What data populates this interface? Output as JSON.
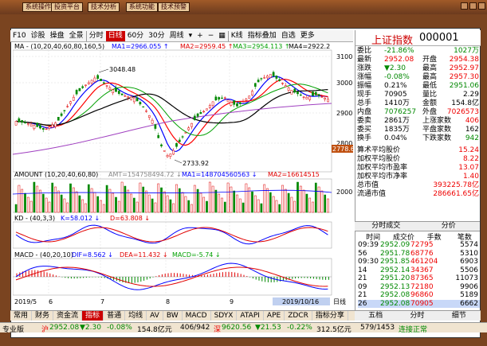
{
  "top_menu": [
    "系统操作",
    "投资平台",
    "技术分析",
    "系统功能",
    "技术预警"
  ],
  "toolbar": {
    "items": [
      "F10",
      "诊股",
      "操盘",
      "全景",
      "分时",
      "日线",
      "60分",
      "30分",
      "周线",
      "K线",
      "指标叠加",
      "自选",
      "更多"
    ],
    "active": "日线"
  },
  "ma_legend": {
    "label": "MA - (10,20,40,60,80,160,5)",
    "ma1": "MA1=2966.055 ↑",
    "ma2": "MA2=2959.45 ↑",
    "ma3": "MA3=2954.113 ↑",
    "ma4": "MA4=2922.2"
  },
  "price_axis": [
    "3100",
    "3000",
    "2900",
    "2800"
  ],
  "price_annotations": {
    "high": "3048.48",
    "low": "2733.92",
    "current": "2778.60"
  },
  "amount_legend": {
    "label": "AMOUNT (10,20,40,60,80)",
    "amt": "AMT=154758494.72 ↓",
    "ma1": "MA1=148704560563 ↓",
    "ma2": "MA2=16614515"
  },
  "amount_axis": "2000",
  "kd_legend": {
    "label": "KD - (40,3,3)",
    "k": "K=58.012 ↓",
    "d": "D=63.808 ↓"
  },
  "macd_legend": {
    "label": "MACD - (40,20,10)",
    "dif": "DIF=8.562 ↓",
    "dea": "DEA=11.432 ↓",
    "macd": "MACD=-5.74 ↓"
  },
  "x_axis": [
    "2019/5",
    "6",
    "7",
    "8",
    "9"
  ],
  "x_current": "2019/10/16",
  "x_suffix": "日线",
  "right_panel": {
    "title_name": "上证指数",
    "title_code": "000001",
    "rows": [
      {
        "l": "委比",
        "lv": "-21.86%",
        "r": "",
        "rv": "1027万",
        "lc": "green",
        "rc": "green"
      },
      {
        "l": "最新",
        "lv": "2952.08",
        "r": "开盘",
        "rv": "2954.38",
        "lc": "red",
        "rc": "red"
      },
      {
        "l": "涨跌",
        "lv": "▼2.30",
        "r": "最高",
        "rv": "2952.97",
        "lc": "green",
        "rc": "red"
      },
      {
        "l": "涨幅",
        "lv": "-0.08%",
        "r": "最高",
        "rv": "2957.30",
        "lc": "green",
        "rc": "red"
      },
      {
        "l": "振幅",
        "lv": "0.21%",
        "r": "最低",
        "rv": "2951.06",
        "lc": "black",
        "rc": "green"
      },
      {
        "l": "现手",
        "lv": "70905",
        "r": "量比",
        "rv": "2.29",
        "lc": "black",
        "rc": "black"
      },
      {
        "l": "总手",
        "lv": "1410万",
        "r": "金额",
        "rv": "154.8亿",
        "lc": "black",
        "rc": "black"
      },
      {
        "l": "内盘",
        "lv": "7076257",
        "r": "外盘",
        "rv": "7026573",
        "lc": "green",
        "rc": "red"
      },
      {
        "l": "委卖",
        "lv": "2861万",
        "r": "上涨家数",
        "rv": "406",
        "lc": "black",
        "rc": "red"
      },
      {
        "l": "委买",
        "lv": "1835万",
        "r": "平盘家数",
        "rv": "162",
        "lc": "black",
        "rc": "black"
      },
      {
        "l": "换手",
        "lv": "0.04%",
        "r": "下跌家数",
        "rv": "942",
        "lc": "black",
        "rc": "green"
      }
    ],
    "stats": [
      {
        "l": "算术平均股价",
        "v": "15.24"
      },
      {
        "l": "加权平均股价",
        "v": "8.22"
      },
      {
        "l": "加权平均市盈率",
        "v": "13.07"
      },
      {
        "l": "加权平均市净率",
        "v": "1.40"
      },
      {
        "l": "总市值",
        "v": "393225.78亿"
      },
      {
        "l": "流通市值",
        "v": "286661.65亿"
      }
    ],
    "tabs": [
      "分时成交",
      "分价"
    ],
    "tick_headers": [
      "时间",
      "成交价",
      "手数",
      "笔数"
    ],
    "ticks": [
      {
        "t": "09:39",
        "p": "2952.09",
        "v": "72795",
        "n": "5574"
      },
      {
        "t": "56",
        "p": "2951.78",
        "v": "68776",
        "n": "5310"
      },
      {
        "t": "09:30",
        "p": "2951.85",
        "v": "461204",
        "n": "6903"
      },
      {
        "t": "14",
        "p": "2952.14",
        "v": "34367",
        "n": "5506"
      },
      {
        "t": "21",
        "p": "2951.20",
        "v": "87365",
        "n": "11073"
      },
      {
        "t": "09",
        "p": "2952.13",
        "v": "72180",
        "n": "9906"
      },
      {
        "t": "21",
        "p": "2952.08",
        "v": "96860",
        "n": "5189"
      },
      {
        "t": "26",
        "p": "2952.08",
        "v": "70905",
        "n": "6662"
      }
    ],
    "bottom_tabs": [
      "五档",
      "分时",
      "细节"
    ]
  },
  "bottom_tabs": [
    "常用",
    "财务",
    "资金流",
    "指标",
    "普通",
    "均线",
    "AV",
    "BW",
    "MACD",
    "SDYX",
    "ATAPI",
    "APE",
    "ZDCR",
    "指标分享"
  ],
  "bottom_active": "指标",
  "status_bar": {
    "app": "专业版",
    "sh": "沪",
    "sh_price": "2952.08",
    "sh_change": "▼2.30",
    "sh_pct": "-0.08%",
    "sh_amount": "154.8亿元",
    "sh_ratio": "406/942",
    "sz": "深",
    "sz_price": "9620.56",
    "sz_change": "▼21.53",
    "sz_pct": "-0.22%",
    "sz_amount": "312.5亿元",
    "sz_ratio": "579/1453",
    "connection": "连接正常"
  },
  "colors": {
    "up": "#e00000",
    "down": "#008800",
    "ma1": "#0000ff",
    "ma2": "#ff0000",
    "ma3": "#00a000",
    "ma4": "#000000"
  }
}
